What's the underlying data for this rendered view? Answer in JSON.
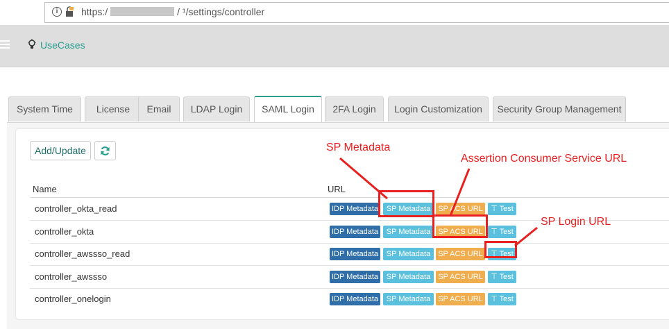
{
  "browser": {
    "url_prefix": "https:/",
    "url_suffix": "/ ¹/settings/controller"
  },
  "header": {
    "brand": "UseCases"
  },
  "tabs": [
    {
      "label": "System Time"
    },
    {
      "label": "License"
    },
    {
      "label": "Email"
    },
    {
      "label": "LDAP Login"
    },
    {
      "label": "SAML Login",
      "active": true
    },
    {
      "label": "2FA Login"
    },
    {
      "label": "Login Customization"
    },
    {
      "label": "Security Group Management"
    }
  ],
  "toolbar": {
    "add_update_label": "Add/Update"
  },
  "table": {
    "columns": [
      "Name",
      "URL"
    ],
    "badges": {
      "idp": "IDP Metadata",
      "sp": "SP Metadata",
      "acs": "SP ACS URL",
      "test": "⊤ Test"
    },
    "rows": [
      {
        "name": "controller_okta_read"
      },
      {
        "name": "controller_okta"
      },
      {
        "name": "controller_awssso_read"
      },
      {
        "name": "controller_awssso"
      },
      {
        "name": "controller_onelogin"
      }
    ]
  },
  "annotations": {
    "sp_metadata": "SP Metadata",
    "acs": "Assertion Consumer Service URL",
    "sp_login": "SP Login URL"
  },
  "colors": {
    "accent": "#2a9d8f",
    "idp_badge": "#2f6ea9",
    "info_badge": "#5bc0de",
    "warning_badge": "#f0ad4e",
    "annotation": "#e8201f"
  }
}
